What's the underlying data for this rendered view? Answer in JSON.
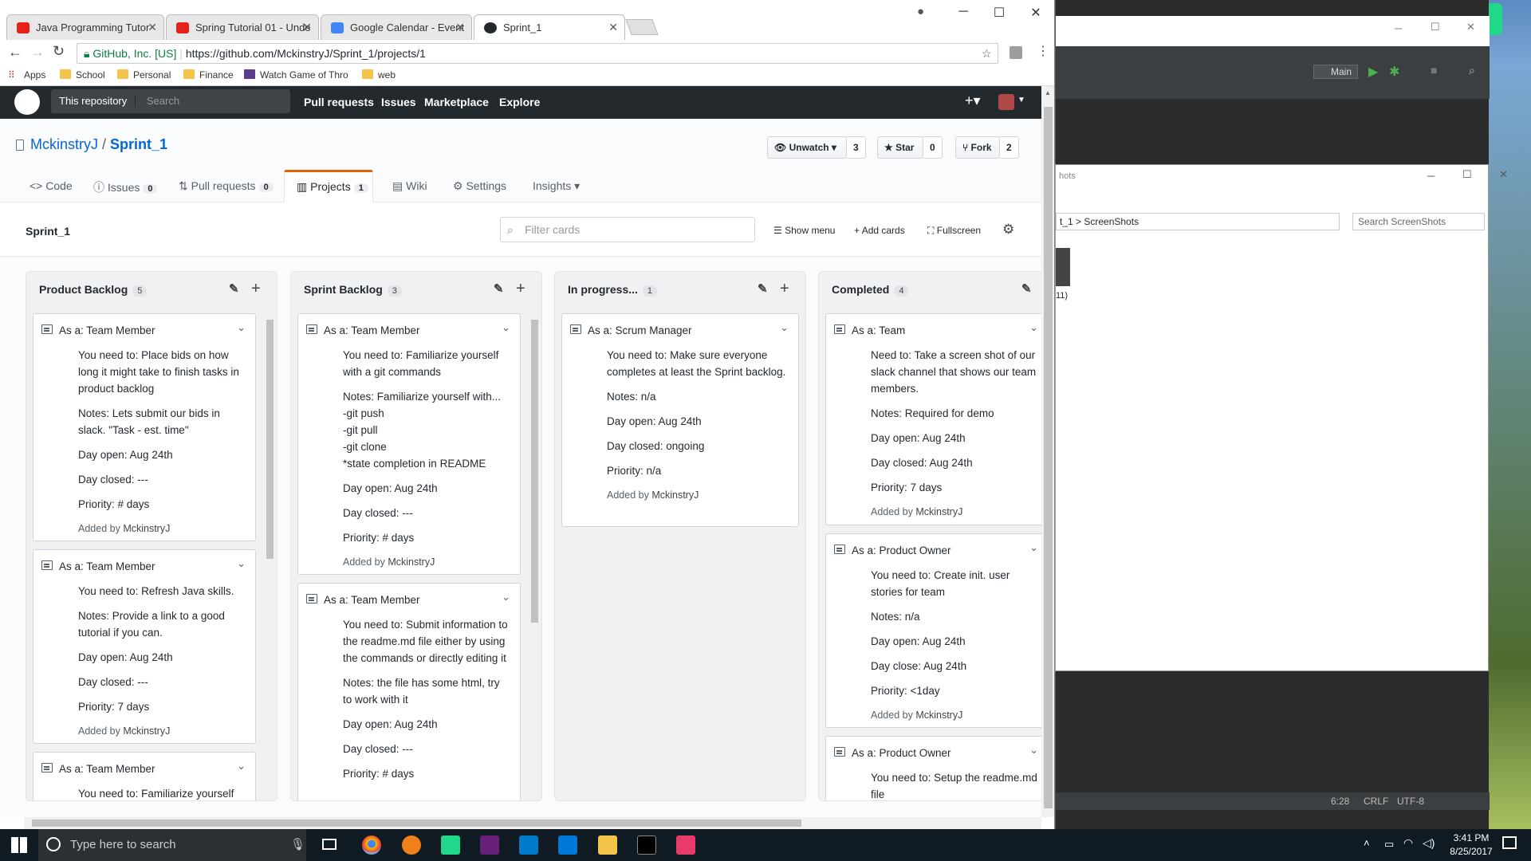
{
  "browser": {
    "tabs": [
      {
        "label": "Java Programming Tutor",
        "color": "#e62117"
      },
      {
        "label": "Spring Tutorial 01 - Unde",
        "color": "#e62117"
      },
      {
        "label": "Google Calendar - Event",
        "color": "#4285f4"
      },
      {
        "label": "Sprint_1",
        "color": "#24292e"
      }
    ],
    "secure_label": "GitHub, Inc. [US]",
    "url": "https://github.com/MckinstryJ/Sprint_1/projects/1",
    "bookmarks": [
      "Apps",
      "School",
      "Personal",
      "Finance",
      "Watch Game of Thro",
      "web"
    ]
  },
  "github": {
    "nav": {
      "scope": "This repository",
      "search_placeholder": "Search",
      "links": [
        "Pull requests",
        "Issues",
        "Marketplace",
        "Explore"
      ]
    },
    "repo": {
      "owner": "MckinstryJ",
      "sep": "/",
      "name": "Sprint_1",
      "watch_label": "Unwatch",
      "watch_count": "3",
      "star_label": "Star",
      "star_count": "0",
      "fork_label": "Fork",
      "fork_count": "2"
    },
    "tabs": [
      {
        "label": "Code",
        "count": ""
      },
      {
        "label": "Issues",
        "count": "0"
      },
      {
        "label": "Pull requests",
        "count": "0"
      },
      {
        "label": "Projects",
        "count": "1"
      },
      {
        "label": "Wiki",
        "count": ""
      },
      {
        "label": "Settings",
        "count": ""
      },
      {
        "label": "Insights",
        "count": ""
      }
    ],
    "project": {
      "name": "Sprint_1",
      "filter_placeholder": "Filter cards",
      "show_menu": "Show menu",
      "add_cards": "Add cards",
      "fullscreen": "Fullscreen"
    },
    "columns": [
      {
        "title": "Product Backlog",
        "count": "5",
        "cards": [
          {
            "title": "As a: Team Member",
            "lines": [
              "You need to: Place bids on how long it might take to finish tasks in product backlog",
              "Notes: Lets submit our bids in slack. \"Task - est. time\"",
              "Day open: Aug 24th",
              "Day closed: ---",
              "Priority: # days"
            ],
            "added_prefix": "Added by",
            "author": "MckinstryJ"
          },
          {
            "title": "As a: Team Member",
            "lines": [
              "You need to: Refresh Java skills.",
              "Notes: Provide a link to a good tutorial if you can.",
              "Day open: Aug 24th",
              "Day closed: ---",
              "Priority: 7 days"
            ],
            "added_prefix": "Added by",
            "author": "MckinstryJ"
          },
          {
            "title": "As a: Team Member",
            "lines": [
              "You need to: Familiarize yourself"
            ],
            "added_prefix": "",
            "author": ""
          }
        ]
      },
      {
        "title": "Sprint Backlog",
        "count": "3",
        "cards": [
          {
            "title": "As a: Team Member",
            "lines": [
              "You need to: Familiarize yourself with a git commands",
              "Notes: Familiarize yourself with...\n-git push\n-git pull\n-git clone\n*state completion in README",
              "Day open: Aug 24th",
              "Day closed: ---",
              "Priority: # days"
            ],
            "added_prefix": "Added by",
            "author": "MckinstryJ"
          },
          {
            "title": "As a: Team Member",
            "lines": [
              "You need to: Submit information to the readme.md file either by using the commands or directly editing it",
              "Notes: the file has some html, try to work with it",
              "Day open: Aug 24th",
              "Day closed: ---",
              "Priority: # days"
            ],
            "added_prefix": "",
            "author": ""
          }
        ]
      },
      {
        "title": "In progress...",
        "count": "1",
        "cards": [
          {
            "title": "As a: Scrum Manager",
            "lines": [
              "You need to: Make sure everyone completes at least the Sprint backlog.",
              "Notes: n/a",
              "Day open: Aug 24th",
              "Day closed: ongoing",
              "Priority: n/a"
            ],
            "added_prefix": "Added by",
            "author": "MckinstryJ"
          }
        ]
      },
      {
        "title": "Completed",
        "count": "4",
        "cards": [
          {
            "title": "As a: Team",
            "lines": [
              "Need to: Take a screen shot of our slack channel that shows our team members.",
              "Notes: Required for demo",
              "Day open: Aug 24th",
              "Day closed: Aug 24th",
              "Priority: 7 days"
            ],
            "added_prefix": "Added by",
            "author": "MckinstryJ"
          },
          {
            "title": "As a: Product Owner",
            "lines": [
              "You need to: Create init. user stories for team",
              "Notes: n/a",
              "Day open: Aug 24th",
              "Day close: Aug 24th",
              "Priority: <1day"
            ],
            "added_prefix": "Added by",
            "author": "MckinstryJ"
          },
          {
            "title": "As a: Product Owner",
            "lines": [
              "You need to: Setup the readme.md file"
            ],
            "added_prefix": "",
            "author": ""
          }
        ]
      }
    ]
  },
  "side_windows": {
    "ide_run_config": "Main",
    "explorer_title": "hots",
    "explorer_breadcrumb": "t_1  >  ScreenShots",
    "explorer_search": "Search ScreenShots",
    "explorer_item_label": "11)",
    "ide_status": [
      "6:28",
      "CRLF",
      "UTF-8"
    ]
  },
  "taskbar": {
    "search_placeholder": "Type here to search",
    "time": "3:41 PM",
    "date": "8/25/2017"
  },
  "colors": {
    "gh_header": "#24292e",
    "link_blue": "#0366d6",
    "project_tab_accent": "#e36209",
    "secure_green": "#0b8043"
  }
}
